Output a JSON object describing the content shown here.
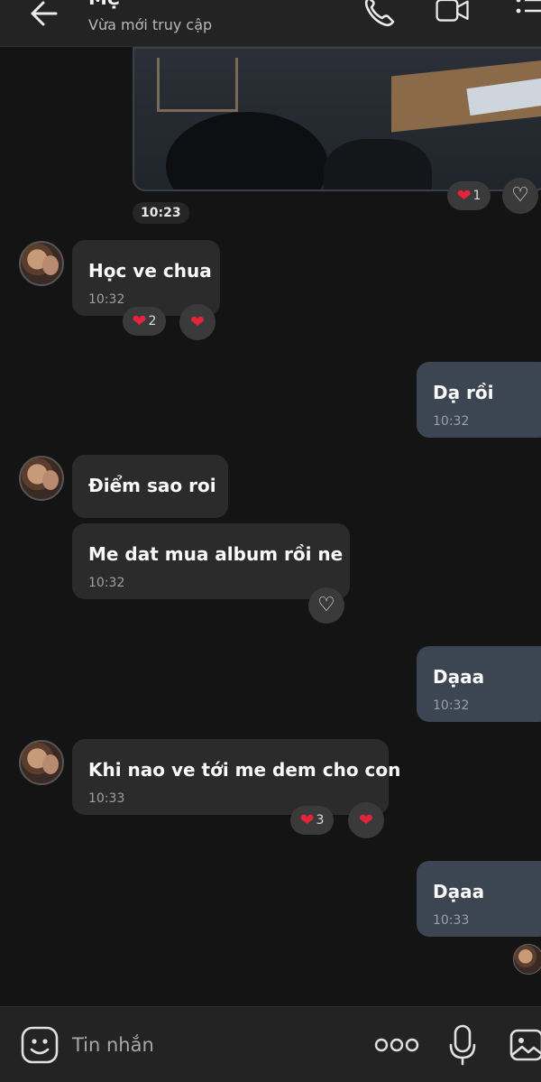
{
  "header": {
    "title": "Mẹ",
    "status": "Vừa mới truy cập"
  },
  "icons": {
    "back": "arrow-left-icon",
    "call": "phone-icon",
    "video": "video-camera-icon",
    "menu": "list-menu-icon",
    "sticker": "sticker-smile-icon",
    "more": "more-dots-icon",
    "mic": "microphone-icon",
    "image": "image-icon"
  },
  "colors": {
    "background": "#141414",
    "incoming_bubble": "#2b2b2b",
    "outgoing_bubble": "#3c4552",
    "heart": "#e5243b"
  },
  "image_message": {
    "time": "10:23",
    "reaction_count": "1"
  },
  "messages": [
    {
      "direction": "in",
      "text": "Học ve chua",
      "time": "10:32",
      "reaction_count": "2"
    },
    {
      "direction": "out",
      "text": "Dạ rồi",
      "time": "10:32"
    },
    {
      "direction": "in",
      "text": "Điểm sao roi"
    },
    {
      "direction": "in",
      "text": "Me dat mua album rồi ne",
      "time": "10:32"
    },
    {
      "direction": "out",
      "text": "Dạaa",
      "time": "10:32"
    },
    {
      "direction": "in",
      "text": "Khi nao ve tới me dem cho con",
      "time": "10:33",
      "reaction_count": "3"
    },
    {
      "direction": "out",
      "text": "Dạaa",
      "time": "10:33"
    }
  ],
  "composer": {
    "placeholder": "Tin nhắn"
  }
}
